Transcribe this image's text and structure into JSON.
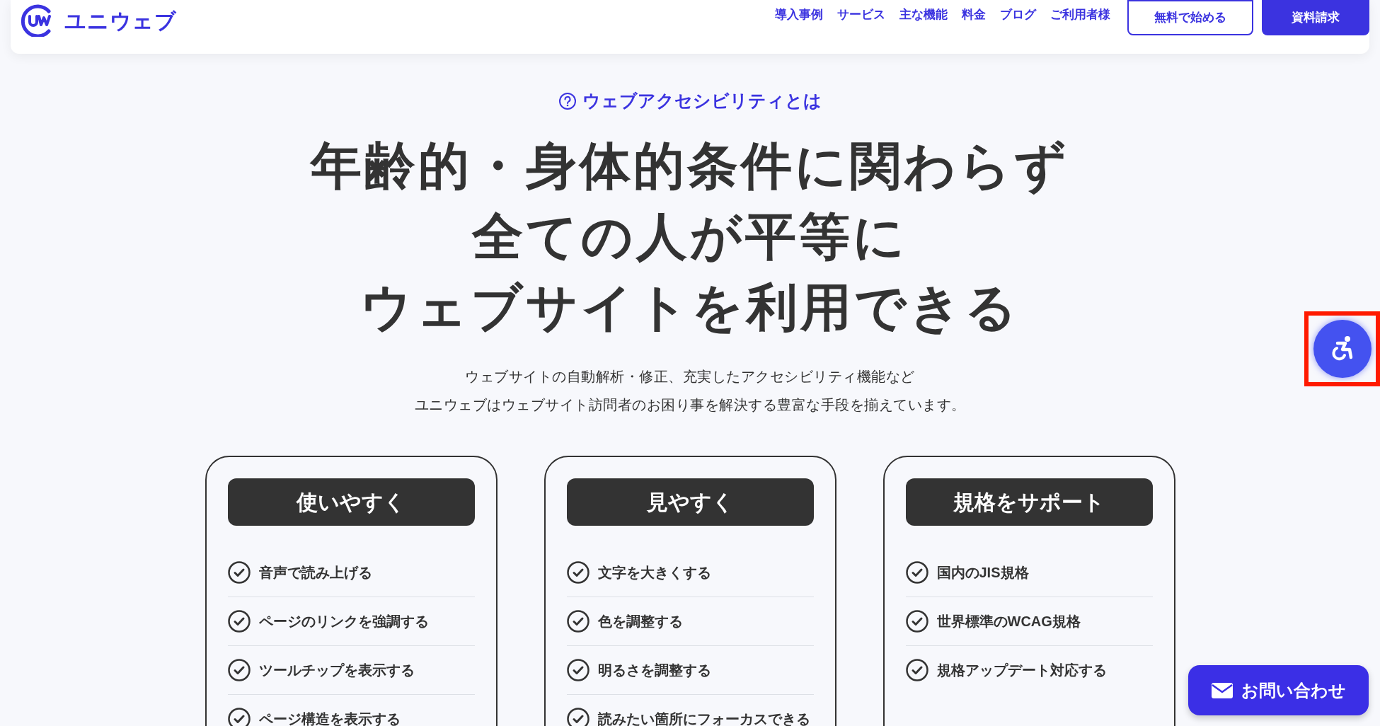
{
  "header": {
    "logo_text": "ユニウェブ",
    "nav": [
      "導入事例",
      "サービス",
      "主な機能",
      "料金",
      "ブログ",
      "ご利用者様"
    ],
    "buttons": [
      {
        "label": "無料で始める",
        "kind": "outline"
      },
      {
        "label": "資料請求",
        "kind": "solid"
      }
    ]
  },
  "hero": {
    "eyebrow": "ウェブアクセシビリティとは",
    "heading": [
      "年齢的・身体的条件に関わらず",
      "全ての人が平等に",
      "ウェブサイトを利用できる"
    ],
    "description": [
      "ウェブサイトの自動解析・修正、充実したアクセシビリティ機能など",
      "ユニウェブはウェブサイト訪問者のお困り事を解決する豊富な手段を揃えています。"
    ]
  },
  "cards": [
    {
      "title": "使いやすく",
      "items": [
        "音声で読み上げる",
        "ページのリンクを強調する",
        "ツールチップを表示する",
        "ページ構造を表示する"
      ]
    },
    {
      "title": "見やすく",
      "items": [
        "文字を大きくする",
        "色を調整する",
        "明るさを調整する",
        "読みたい箇所にフォーカスできる"
      ]
    },
    {
      "title": "規格をサポート",
      "items": [
        "国内のJIS規格",
        "世界標準のWCAG規格",
        "規格アップデート対応する"
      ]
    }
  ],
  "accessibility_button": {
    "highlighted": true
  },
  "contact_button": {
    "label": "お問い合わせ"
  }
}
